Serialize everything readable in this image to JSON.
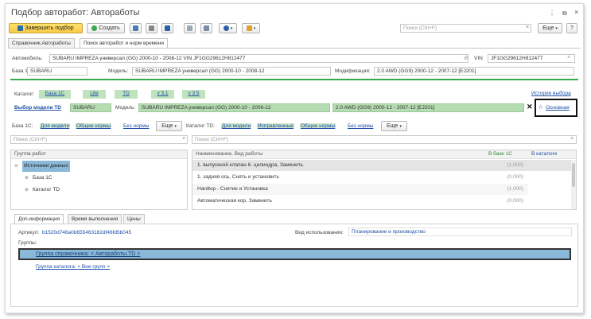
{
  "window": {
    "title": "Подбор авторабот: Автоработы",
    "menu_icon": "⋮",
    "max_icon": "⧉",
    "close_icon": "×"
  },
  "toolbar": {
    "finish_label": "Завершить подбор",
    "create_label": "Создать",
    "search_placeholder": "Поиск (Ctrl+F)",
    "more_label": "Еще",
    "help_label": "?"
  },
  "tabs": [
    {
      "label": "Справочник.Автоработы"
    },
    {
      "label": "Поиск авторабот и норм времени"
    }
  ],
  "car": {
    "auto_label": "Автомобиль:",
    "auto_value": "SUBARU IMPREZA универсал (GG) 2000-10 - 2008-12 VIN JF1GG29612H812477",
    "vin_label": "VIN",
    "vin_value": "JF1GG29612H812477",
    "base_label": "База 1С:",
    "base_value": "SUBARU",
    "model_label": "Модель:",
    "model_value": "SUBARU IMPREZA универсал (GG) 2000-10 - 2008-12",
    "mod_label": "Модификация:",
    "mod_value": "2.0 AWD (GG9) 2000-12 - 2007-12 [EJ201]"
  },
  "catalog": {
    "label": "Каталог:",
    "items": [
      "База 1С",
      "Lite",
      "TD",
      "v 3.1",
      "v 3.5"
    ],
    "history": "История выбора"
  },
  "td": {
    "select_label": "Выбор модели TD",
    "brand": "SUBARU",
    "model_label": "Модель:",
    "model": "SUBARU IMPREZA универсал (GG) 2000-10 - 2008-12",
    "mod": "2.0 AWD (GG9) 2000-12 - 2007-12 [EJ201]",
    "clear": "✕",
    "main": "Основная",
    "star": "☆"
  },
  "filters": {
    "base_label": "База 1С:",
    "base_links": [
      "Для модели",
      "Общие нормы",
      "Без нормы"
    ],
    "cat_label": "Каталог TD:",
    "cat_links": [
      "Для модели",
      "Исправленные",
      "Общие нормы",
      "Без нормы"
    ],
    "more": "Еще"
  },
  "left_search": "Поиск (Ctrl+F)",
  "right_search": "Поиск (Ctrl+F)",
  "group_tree": {
    "header": "Группа работ",
    "items": [
      {
        "label": "Источники данных",
        "selected": true
      },
      {
        "label": "База 1С",
        "selected": false
      },
      {
        "label": "Каталог TD",
        "selected": false
      }
    ]
  },
  "works_table": {
    "headers": [
      "Наименование, Вид работы",
      "В базе 1С",
      "В каталоге"
    ],
    "rows": [
      {
        "name": "1. выпускной клапан 6. цилиндра, Заменить",
        "base": "(1,000)",
        "cat": ""
      },
      {
        "name": "1. задняя ось, Снять и установить",
        "base": "(0,000)",
        "cat": ""
      },
      {
        "name": "Hardtop - Снятие и Установка",
        "base": "(1,000)",
        "cat": ""
      },
      {
        "name": "Автоматическая кор. Заменить",
        "base": "(0,000)",
        "cat": ""
      }
    ]
  },
  "bottom_tabs": [
    {
      "label": "Доп.информация"
    },
    {
      "label": "Время выполнения"
    },
    {
      "label": "Цены"
    }
  ],
  "info": {
    "article_label": "Артикул:",
    "article_value": "b1520d746a0b655463182df46fd5b045",
    "usage_label": "Вид использования:",
    "usage_value": "Планирование и производство",
    "groups_label": "Группы:",
    "groups": [
      "Группа справочника: < Автоработы.TD >",
      "Группа каталога: < Вне групп >"
    ]
  },
  "colors": {
    "accent": "#1c4fa6",
    "yellow": "#f7c948",
    "green": "#bfe3bd",
    "select": "#8ab8d8"
  }
}
